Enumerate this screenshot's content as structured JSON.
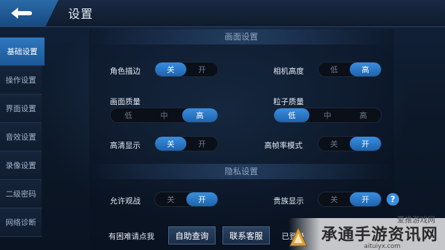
{
  "header": {
    "title": "设置",
    "back_icon": "back-arrow-icon"
  },
  "sidebar": {
    "items": [
      {
        "label": "基础设置",
        "active": true
      },
      {
        "label": "操作设置",
        "active": false
      },
      {
        "label": "界面设置",
        "active": false
      },
      {
        "label": "音效设置",
        "active": false
      },
      {
        "label": "录像设置",
        "active": false
      },
      {
        "label": "二级密码",
        "active": false
      },
      {
        "label": "网络诊断",
        "active": false
      }
    ]
  },
  "sections": {
    "display": "画面设置",
    "privacy": "隐私设置"
  },
  "settings": {
    "outline": {
      "label": "角色描边",
      "options": [
        "关",
        "开"
      ],
      "selected": "关"
    },
    "camera_height": {
      "label": "相机高度",
      "options": [
        "低",
        "高"
      ],
      "selected": "高"
    },
    "quality": {
      "label": "画面质量",
      "options": [
        "低",
        "中",
        "高"
      ],
      "selected": "高"
    },
    "particle": {
      "label": "粒子质量",
      "options": [
        "低",
        "中",
        "高"
      ],
      "selected": "低"
    },
    "hd": {
      "label": "高清显示",
      "options": [
        "关",
        "开"
      ],
      "selected": "关"
    },
    "high_fps": {
      "label": "高帧率模式",
      "options": [
        "关",
        "开"
      ],
      "selected": "开"
    },
    "allow_watch": {
      "label": "允许观战",
      "options": [
        "关",
        "开"
      ],
      "selected": "开"
    },
    "noble": {
      "label": "贵族显示",
      "options": [
        "关",
        "开"
      ],
      "selected": "开"
    }
  },
  "bottom": {
    "help_text": "有困难请点我",
    "self_help_button": "自助查询",
    "support_button": "联系客服",
    "logged_text": "已登录"
  },
  "watermark": {
    "main": "承通手游资讯网",
    "top": "爱推游戏网",
    "url": "aituiyx.com"
  },
  "colors": {
    "accent": "#2f78c0",
    "toggle_on": "#3a8ee0",
    "background": "#0b1524"
  }
}
